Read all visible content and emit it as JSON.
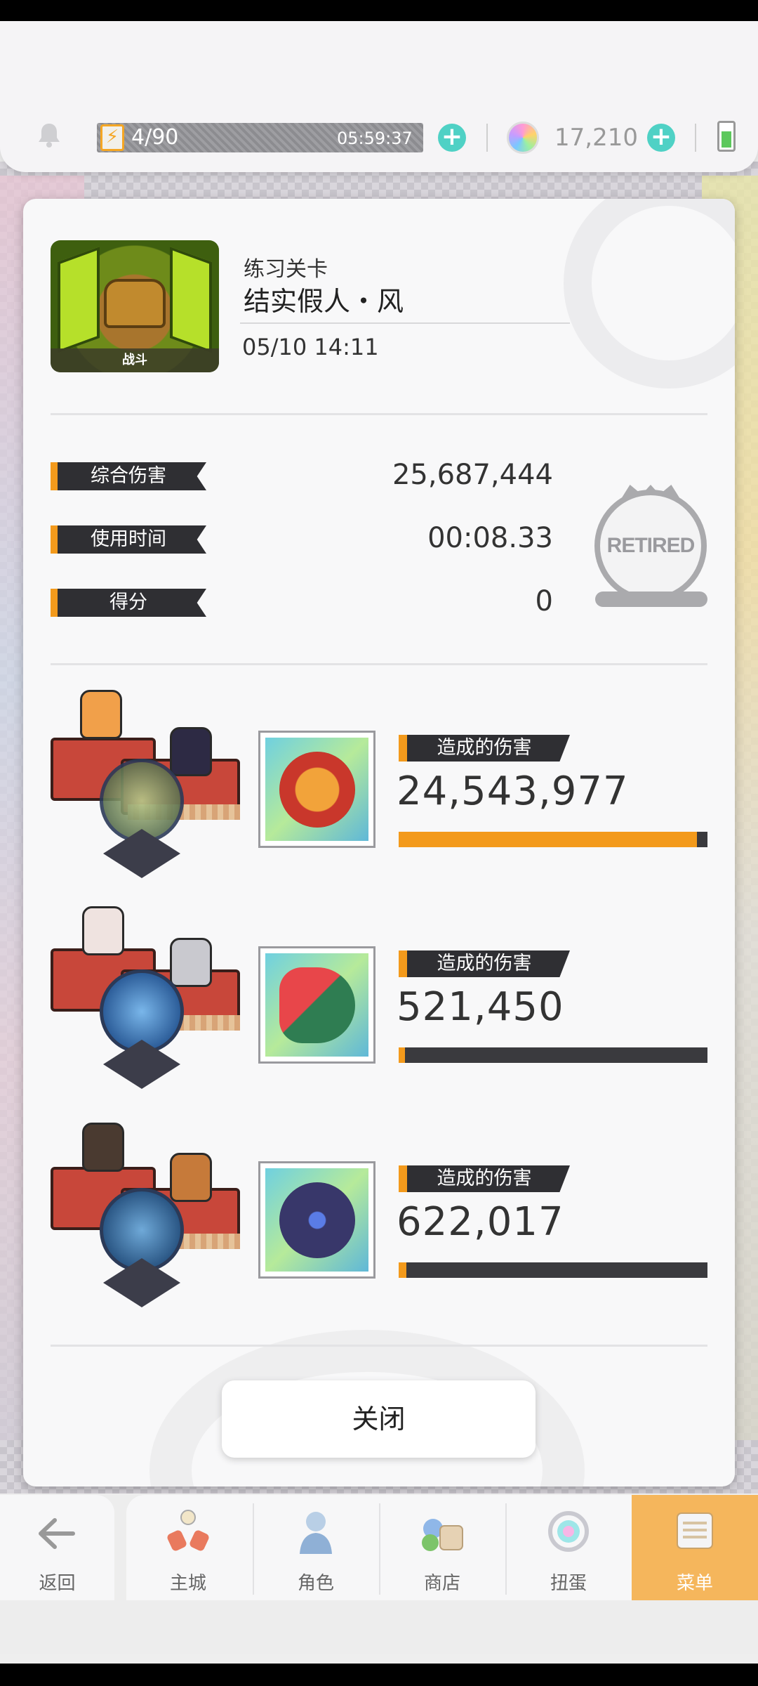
{
  "status": {
    "energy": "4/90",
    "energy_timer": "05:59:37",
    "gems": "17,210"
  },
  "stage": {
    "badge": "战斗",
    "type": "练习关卡",
    "name": "结实假人・风",
    "datetime": "05/10 14:11"
  },
  "stats": {
    "total_damage_label": "综合伤害",
    "total_damage": "25,687,444",
    "time_label": "使用时间",
    "time": "00:08.33",
    "score_label": "得分",
    "score": "0",
    "result_stamp": "RETIRED"
  },
  "teams": [
    {
      "label": "造成的伤害",
      "damage": "24,543,977",
      "share": 0.965
    },
    {
      "label": "造成的伤害",
      "damage": "521,450",
      "share": 0.02
    },
    {
      "label": "造成的伤害",
      "damage": "622,017",
      "share": 0.025
    }
  ],
  "close_label": "关闭",
  "nav": {
    "back": "返回",
    "town": "主城",
    "characters": "角色",
    "shop": "商店",
    "gacha": "扭蛋",
    "menu": "菜单"
  },
  "colors": {
    "accent": "#f39a1c",
    "label_bg": "#2f2f33",
    "plus": "#4fd1c5"
  }
}
